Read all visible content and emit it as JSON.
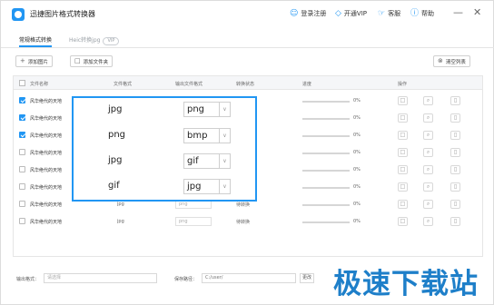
{
  "app": {
    "title": "迅捷图片格式转换器",
    "titlebar": {
      "login_label": "登录注册",
      "vip_label": "开通VIP",
      "service_label": "客服",
      "help_label": "帮助"
    }
  },
  "tabs": [
    {
      "label": "常规格式转换",
      "active": true
    },
    {
      "label": "Heic转换jpg",
      "active": false,
      "badge": "VIP"
    }
  ],
  "toolbar": {
    "add_image_label": "添加图片",
    "add_folder_label": "添加文件夹",
    "clear_list_label": "清空列表"
  },
  "table": {
    "headers": {
      "name": "文件名称",
      "format": "文件格式",
      "output_format": "输出文件格式",
      "status": "转换状态",
      "progress": "进度",
      "actions": "操作"
    },
    "rows": [
      {
        "checked": true,
        "name": "风华绝代的天地",
        "type": "jpg",
        "output": "png",
        "status": "",
        "progress": "0%"
      },
      {
        "checked": true,
        "name": "风华绝代的天地",
        "type": "png",
        "output": "bmp",
        "status": "",
        "progress": "0%"
      },
      {
        "checked": true,
        "name": "风华绝代的天地",
        "type": "jpg",
        "output": "gif",
        "status": "",
        "progress": "0%"
      },
      {
        "checked": false,
        "name": "风华绝代的天地",
        "type": "gif",
        "output": "jpg",
        "status": "",
        "progress": "0%"
      },
      {
        "checked": false,
        "name": "风华绝代的天地",
        "type": "",
        "output": "",
        "status": "",
        "progress": "0%"
      },
      {
        "checked": false,
        "name": "风华绝代的天地",
        "type": "",
        "output": "",
        "status": "",
        "progress": "0%"
      },
      {
        "checked": false,
        "name": "风华绝代的天地",
        "type": "jpg",
        "output": "png",
        "status": "待转换",
        "progress": "0%"
      },
      {
        "checked": false,
        "name": "风华绝代的天地",
        "type": "jpg",
        "output": "png",
        "status": "待转换",
        "progress": "0%"
      }
    ]
  },
  "highlight": {
    "rows": [
      {
        "type": "jpg",
        "output": "png"
      },
      {
        "type": "png",
        "output": "bmp"
      },
      {
        "type": "jpg",
        "output": "gif"
      },
      {
        "type": "gif",
        "output": "jpg"
      }
    ]
  },
  "bottombar": {
    "format_label": "输出格式：",
    "format_placeholder": "请选择",
    "path_label": "保存路径：",
    "path_value": "C:/user/",
    "change_label": "更改"
  },
  "watermark": "极速下载站",
  "colors": {
    "accent": "#2196f3"
  },
  "icons": {
    "user": "user-icon",
    "vip": "diamond-icon",
    "service": "headset-icon",
    "help": "question-icon",
    "open_folder": "folder-icon",
    "preview": "search-icon",
    "delete": "trash-icon"
  }
}
